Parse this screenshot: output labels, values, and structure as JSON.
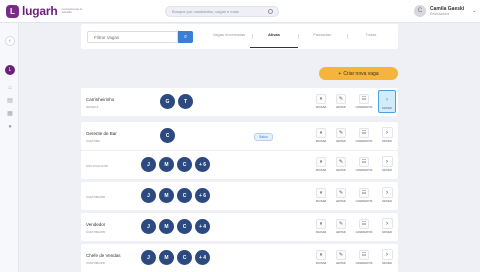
{
  "brand": {
    "name": "lugarh",
    "tagline": "recrutamento & seleção",
    "logo_letter": "L",
    "color": "#6a1f7a"
  },
  "search": {
    "placeholder": "Busque por candidatos, vagas e mais"
  },
  "user": {
    "name": "Camila Gaeski",
    "role": "Recrutadora",
    "initial": "C"
  },
  "sidebar": {
    "org_initial": "L",
    "collapse_glyph": "‹",
    "icons": [
      "home-icon",
      "briefcase-icon",
      "grid-icon",
      "location-icon"
    ]
  },
  "filter": {
    "placeholder": "Filtrar Vagas",
    "button_glyph": "⌕"
  },
  "tabs": [
    {
      "label": "Vagas encerradas",
      "active": false
    },
    {
      "label": "Ativas",
      "active": true
    },
    {
      "label": "Pausadas",
      "active": false
    },
    {
      "label": "Todas",
      "active": false
    }
  ],
  "new_job": {
    "label": "Criar nova vaga",
    "glyph": "+"
  },
  "action_labels": {
    "pause": "PAUSAR",
    "edit": "EDITAR",
    "candidates": "CANDIDATOS",
    "move": "MOVER"
  },
  "action_glyphs": {
    "pause": "⏸",
    "edit": "✎",
    "candidates": "☷",
    "move": "›"
  },
  "accent": "#3b7fd4",
  "jobs": [
    {
      "title": "Carrinheirinho",
      "city": "IRANDUÍ",
      "avatars": [
        "G",
        "T"
      ],
      "more": "",
      "badge": "",
      "highlighted": true
    },
    {
      "title": "Gerente de Bar",
      "city": "CURITIBA",
      "avatars": [
        "C"
      ],
      "more": "",
      "badge": "Salvo",
      "highlighted": false
    },
    {
      "title": "",
      "city": "SÃO PAULO/SP",
      "avatars": [
        "J",
        "M",
        "C"
      ],
      "more": "+ 6",
      "badge": "",
      "highlighted": false
    },
    {
      "title": "",
      "city": "CURITIBA/PR",
      "avatars": [
        "J",
        "M",
        "C"
      ],
      "more": "+ 6",
      "badge": "",
      "highlighted": false
    },
    {
      "title": "Vendedor",
      "city": "CURITIBA/PR",
      "avatars": [
        "J",
        "M",
        "C"
      ],
      "more": "+ 4",
      "badge": "",
      "highlighted": false
    },
    {
      "title": "Chefe de Vendas",
      "city": "CURITIBA/PR",
      "avatars": [
        "J",
        "M",
        "C"
      ],
      "more": "+ 4",
      "badge": "",
      "highlighted": false
    }
  ]
}
